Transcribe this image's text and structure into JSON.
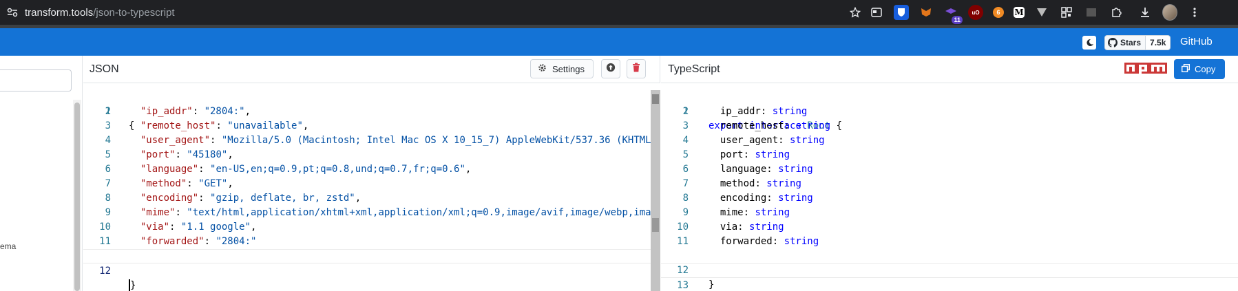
{
  "browser": {
    "host": "transform.tools",
    "path": "/json-to-typescript",
    "extension_badge": "11",
    "extensions": [
      "bitwarden-icon",
      "metamask-icon",
      "graduation-icon",
      "ublock-icon",
      "coin-icon",
      "medium-icon",
      "vuejs-icon",
      "qr-icon",
      "puzzle-icon",
      "download-icon"
    ]
  },
  "header": {
    "stars_label": "Stars",
    "stars_count": "7.5k",
    "github_label": "GitHub"
  },
  "sidebar": {
    "partial_item": "ema"
  },
  "json_panel": {
    "title": "JSON",
    "settings_label": "Settings",
    "lines": [
      {
        "n": "1"
      },
      {
        "n": "2",
        "key": "\"ip_addr\"",
        "val": "\"2804:\"",
        "tail": ","
      },
      {
        "n": "3",
        "key": "\"remote_host\"",
        "val": "\"unavailable\"",
        "tail": ","
      },
      {
        "n": "4",
        "key": "\"user_agent\"",
        "val": "\"Mozilla/5.0 (Macintosh; Intel Mac OS X 10_15_7) AppleWebKit/537.36 (KHTML,",
        "tail": ""
      },
      {
        "n": "5",
        "key": "\"port\"",
        "val": "\"45180\"",
        "tail": ","
      },
      {
        "n": "6",
        "key": "\"language\"",
        "val": "\"en-US,en;q=0.9,pt;q=0.8,und;q=0.7,fr;q=0.6\"",
        "tail": ","
      },
      {
        "n": "7",
        "key": "\"method\"",
        "val": "\"GET\"",
        "tail": ","
      },
      {
        "n": "8",
        "key": "\"encoding\"",
        "val": "\"gzip, deflate, br, zstd\"",
        "tail": ","
      },
      {
        "n": "9",
        "key": "\"mime\"",
        "val": "\"text/html,application/xhtml+xml,application/xml;q=0.9,image/avif,image/webp,image",
        "tail": ""
      },
      {
        "n": "10",
        "key": "\"via\"",
        "val": "\"1.1 google\"",
        "tail": ","
      },
      {
        "n": "11",
        "key": "\"forwarded\"",
        "val": "\"2804:\"",
        "tail": ""
      },
      {
        "n": "12"
      }
    ],
    "open_brace": "{",
    "close_brace": "}"
  },
  "ts_panel": {
    "title": "TypeScript",
    "copy_label": "Copy",
    "npm_label": "npm",
    "kw_export": "export",
    "kw_interface": "interface",
    "type_name": "Root",
    "open_brace": "{",
    "close_brace": "}",
    "fields": [
      {
        "n": "2",
        "name": "ip_addr",
        "type": "string"
      },
      {
        "n": "3",
        "name": "remote_host",
        "type": "string"
      },
      {
        "n": "4",
        "name": "user_agent",
        "type": "string"
      },
      {
        "n": "5",
        "name": "port",
        "type": "string"
      },
      {
        "n": "6",
        "name": "language",
        "type": "string"
      },
      {
        "n": "7",
        "name": "method",
        "type": "string"
      },
      {
        "n": "8",
        "name": "encoding",
        "type": "string"
      },
      {
        "n": "9",
        "name": "mime",
        "type": "string"
      },
      {
        "n": "10",
        "name": "via",
        "type": "string"
      },
      {
        "n": "11",
        "name": "forwarded",
        "type": "string"
      }
    ],
    "line_numbers": [
      "1",
      "12",
      "13"
    ]
  },
  "colors": {
    "header_blue": "#1473d6",
    "key_red": "#a31515",
    "string_blue": "#0451a5",
    "keyword_blue": "#0000ff",
    "type_teal": "#267f99",
    "line_number": "#237893",
    "delete_red": "#d73a49",
    "npm_red": "#cb3837"
  }
}
